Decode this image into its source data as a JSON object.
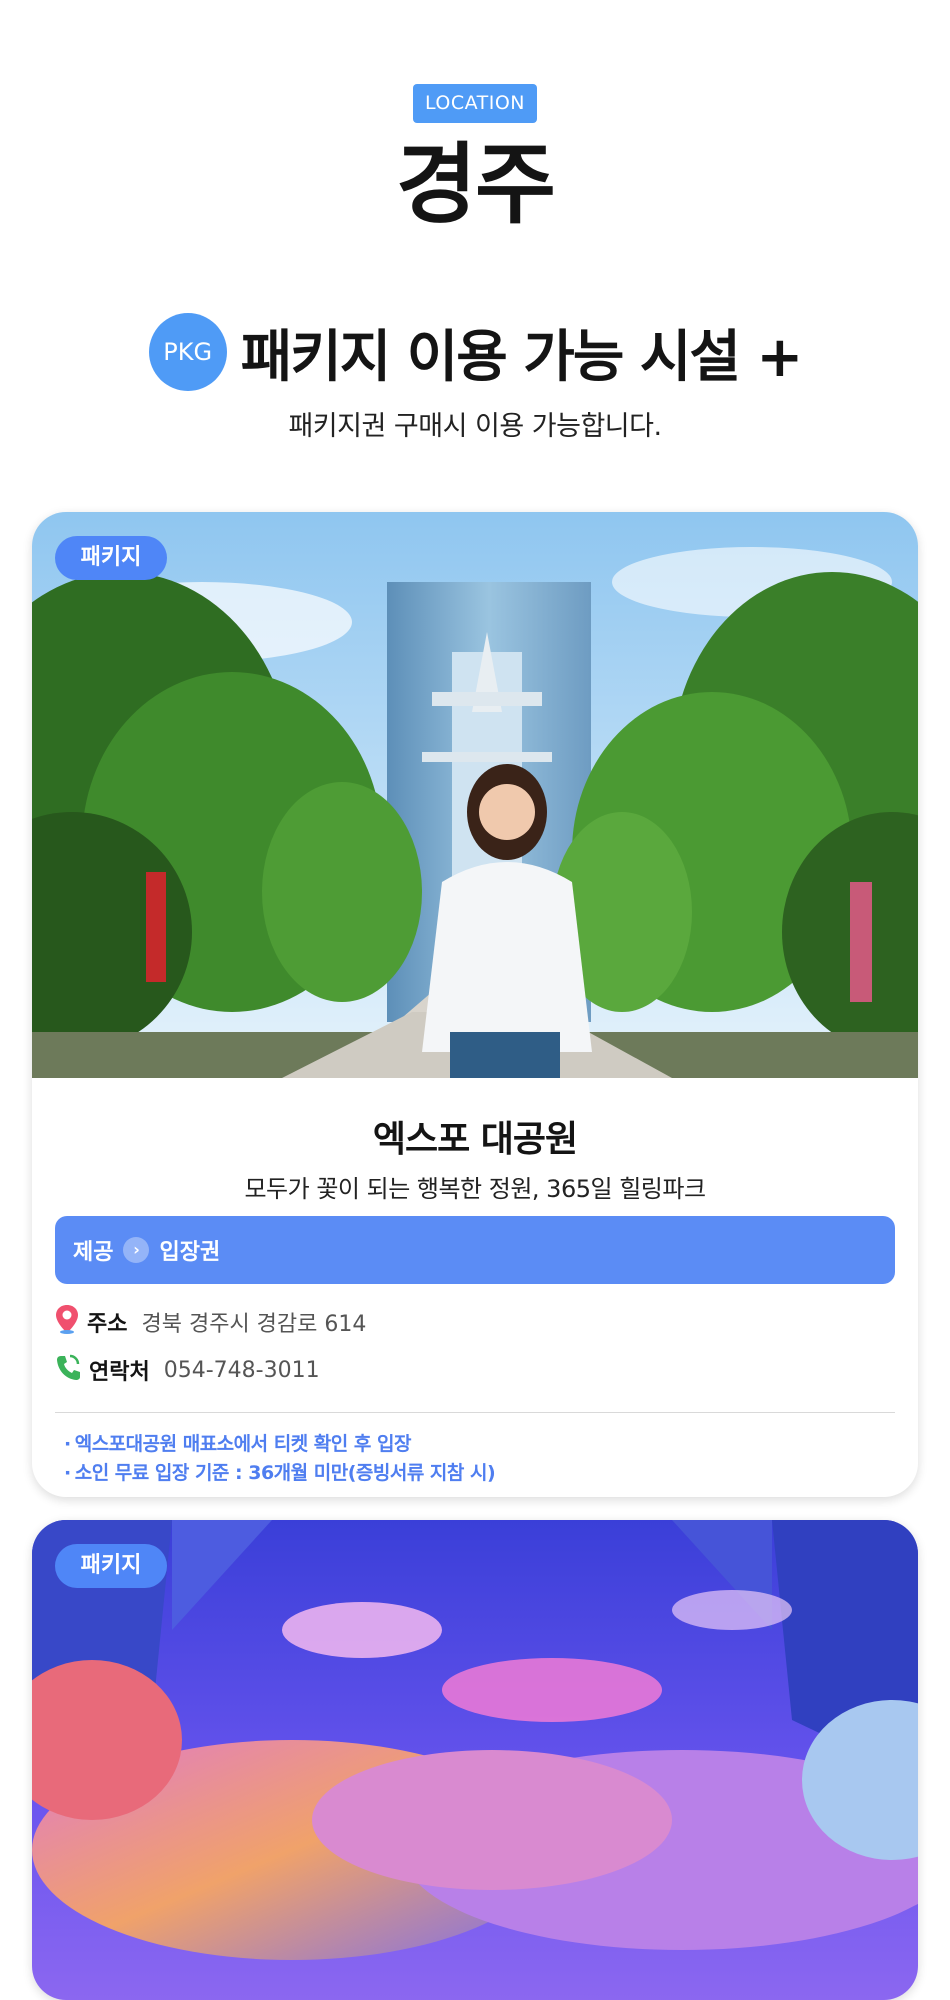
{
  "header": {
    "location_tag": "LOCATION",
    "city": "경주",
    "pkg_badge": "PKG",
    "section_title": "패키지 이용 가능 시설 +",
    "subtitle": "패키지권 구매시 이용 가능합니다."
  },
  "cards": [
    {
      "badge": "패키지",
      "name": "엑스포 대공원",
      "description": "모두가 꽃이 되는 행복한 정원, 365일 힐링파크",
      "provide_label": "제공",
      "provide_value": "입장권",
      "address_label": "주소",
      "address_value": "경북 경주시 경감로 614",
      "tel_label": "연락처",
      "tel_value": "054-748-3011",
      "notes": [
        "엑스포대공원 매표소에서 티켓 확인 후 입장",
        "소인 무료 입장 기준 : 36개월 미만(증빙서류 지참 시)"
      ]
    },
    {
      "badge": "패키지"
    }
  ],
  "colors": {
    "accent": "#4f9bf6",
    "badge": "#4f86f7",
    "provide_bar": "#5b8cf5",
    "note_text": "#4f7ef0"
  },
  "icons": {
    "location": "map-pin-icon",
    "phone": "phone-icon",
    "chevron": "chevron-right-icon"
  }
}
